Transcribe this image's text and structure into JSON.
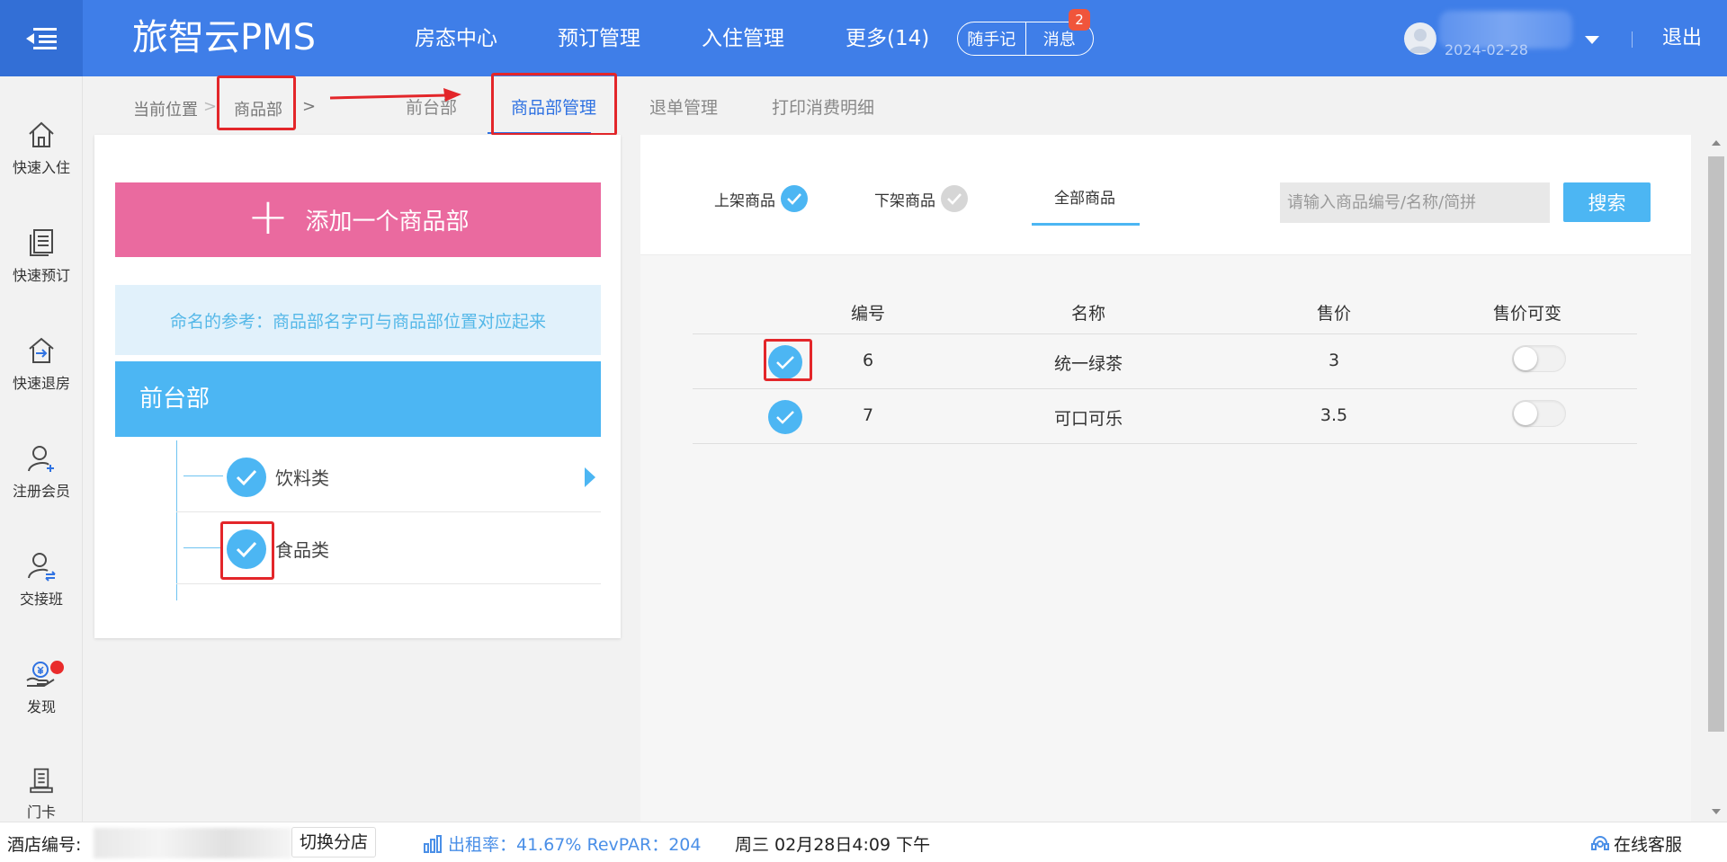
{
  "colors": {
    "topbar": "#3f7ee8",
    "accent": "#4cb6f3",
    "pink": "#ea6a9f",
    "highlight": "#e3262a"
  },
  "header": {
    "brand": "旅智云PMS",
    "nav": [
      "房态中心",
      "预订管理",
      "入住管理",
      "更多(14)"
    ],
    "quick_note": "随手记",
    "messages": "消息",
    "message_count": "2",
    "user_date": "2024-02-28",
    "logout": "退出"
  },
  "sidebar": {
    "items": [
      {
        "label": "快速入住",
        "icon": "home-icon"
      },
      {
        "label": "快速预订",
        "icon": "document-icon"
      },
      {
        "label": "快速退房",
        "icon": "checkout-icon"
      },
      {
        "label": "注册会员",
        "icon": "add-user-icon"
      },
      {
        "label": "交接班",
        "icon": "shift-handover-icon"
      },
      {
        "label": "发现",
        "icon": "discover-icon"
      },
      {
        "label": "门卡",
        "icon": "card-icon"
      }
    ]
  },
  "breadcrumb": {
    "prefix": "当前位置",
    "current": "商品部",
    "sep": ">"
  },
  "tabs": [
    "前台部",
    "商品部管理",
    "退单管理",
    "打印消费明细"
  ],
  "left_panel": {
    "add_button": "添加一个商品部",
    "tip": "命名的参考：商品部名字可与商品部位置对应起来",
    "department": "前台部",
    "categories": [
      "饮料类",
      "食品类"
    ]
  },
  "filter": {
    "on_shelf": "上架商品",
    "off_shelf": "下架商品",
    "all": "全部商品",
    "search_placeholder": "请输入商品编号/名称/简拼",
    "search_button": "搜索"
  },
  "table": {
    "headers": [
      "编号",
      "名称",
      "售价",
      "售价可变"
    ],
    "rows": [
      {
        "id": "6",
        "name": "统一绿茶",
        "price": "3",
        "variable": false
      },
      {
        "id": "7",
        "name": "可口可乐",
        "price": "3.5",
        "variable": false
      }
    ]
  },
  "status": {
    "hotel_label": "酒店编号:",
    "switch_branch": "切换分店",
    "occupancy": "出租率：41.67% RevPAR：204",
    "datetime": "周三 02月28日4:09 下午",
    "service": "在线客服"
  }
}
